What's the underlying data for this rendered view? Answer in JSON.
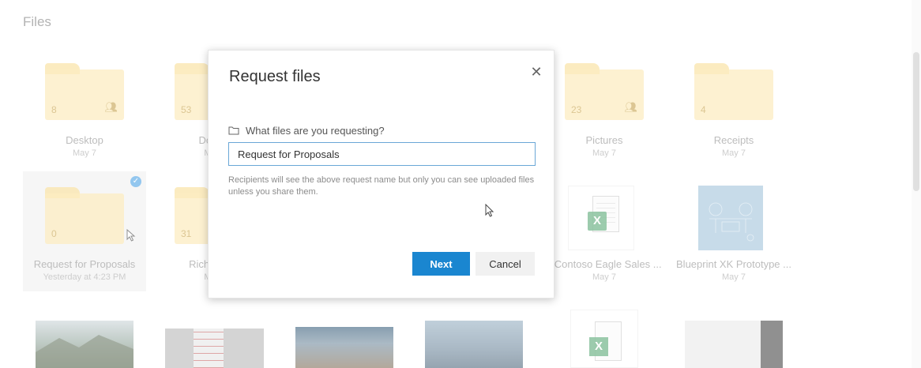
{
  "page": {
    "title": "Files"
  },
  "row1": [
    {
      "type": "folder",
      "count": "8",
      "shared": true,
      "name": "Desktop",
      "date": "May 7"
    },
    {
      "type": "folder",
      "count": "53",
      "shared": false,
      "name": "Doc",
      "date": "M"
    },
    {
      "type": "hidden"
    },
    {
      "type": "hidden"
    },
    {
      "type": "folder",
      "count": "23",
      "shared": true,
      "name": "Pictures",
      "date": "May 7"
    },
    {
      "type": "folder",
      "count": "4",
      "shared": false,
      "name": "Receipts",
      "date": "May 7"
    }
  ],
  "row2": [
    {
      "type": "folder",
      "count": "0",
      "shared": false,
      "selected": true,
      "name": "Request for Proposals",
      "date": "Yesterday at 4:23 PM"
    },
    {
      "type": "folder",
      "count": "31",
      "shared": false,
      "name": "Rich Me",
      "date": "M"
    },
    {
      "type": "hidden"
    },
    {
      "type": "hidden"
    },
    {
      "type": "xlsx",
      "name": "ll Contoso Eagle Sales ...",
      "date": "May 7"
    },
    {
      "type": "image",
      "name": "Blueprint XK Prototype ...",
      "date": "May 7"
    }
  ],
  "icons": {
    "check": "checkmark-icon",
    "folder": "folder-icon",
    "people": "shared-people-icon",
    "excel": "excel-icon",
    "close": "close-icon"
  },
  "excel_badge": "X",
  "dialog": {
    "title": "Request files",
    "close_glyph": "✕",
    "question_label": "What files are you requesting?",
    "input_value": "Request for Proposals",
    "help_text": "Recipients will see the above request name but only you can see uploaded files unless you share them.",
    "next_label": "Next",
    "cancel_label": "Cancel"
  },
  "colors": {
    "accent": "#1a86d0",
    "folder": "#fbe3a0",
    "excel": "#4ea36c"
  }
}
